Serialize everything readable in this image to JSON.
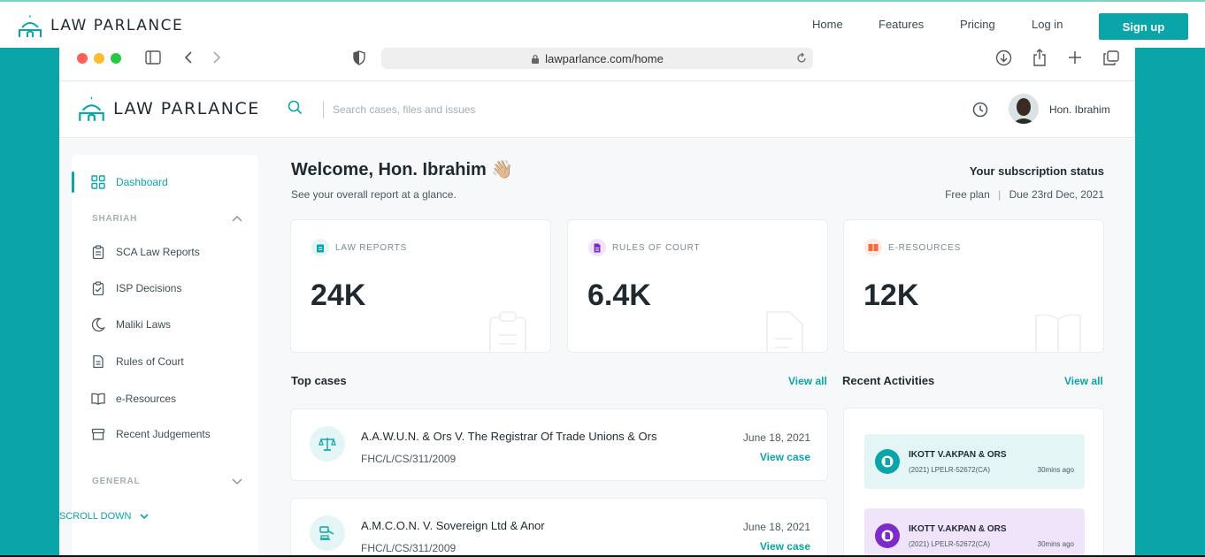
{
  "site": {
    "brand": "LAW PARLANCE",
    "nav": [
      "Home",
      "Features",
      "Pricing",
      "Log in"
    ],
    "signup_label": "Sign up"
  },
  "browser": {
    "url": "lawparlance.com/home",
    "traffic_light_colors": [
      "#ff5f57",
      "#febc2e",
      "#28c840"
    ]
  },
  "app": {
    "brand": "LAW PARLANCE",
    "search_placeholder": "Search cases, files and issues",
    "user_name": "Hon. Ibrahim"
  },
  "sidebar": {
    "active": "Dashboard",
    "sections": [
      {
        "title": "SHARIAH",
        "items": [
          {
            "label": "SCA Law Reports",
            "icon": "clipboard-list-icon"
          },
          {
            "label": "ISP Decisions",
            "icon": "clipboard-check-icon"
          },
          {
            "label": "Maliki Laws",
            "icon": "crescent-moon-icon"
          },
          {
            "label": "Rules of Court",
            "icon": "document-icon"
          },
          {
            "label": "e-Resources",
            "icon": "open-book-icon"
          },
          {
            "label": "Recent Judgements",
            "icon": "archive-box-icon"
          }
        ]
      },
      {
        "title": "GENERAL",
        "items": []
      }
    ],
    "scroll_hint": "SCROLL DOWN"
  },
  "welcome": {
    "title": "Welcome, Hon. Ibrahim 👋🏼",
    "subtitle": "See your overall report at a glance.",
    "subscription_title": "Your subscription status",
    "plan": "Free plan",
    "due": "Due 23rd Dec, 2021"
  },
  "stats": [
    {
      "label": "LAW REPORTS",
      "value": "24K",
      "color": "#0aa5a8",
      "bg": "#e3f5f5"
    },
    {
      "label": "RULES OF COURT",
      "value": "6.4K",
      "color": "#7b2cc9",
      "bg": "#f0e4fb"
    },
    {
      "label": "E-RESOURCES",
      "value": "12K",
      "color": "#f26a3d",
      "bg": "#fdebe4"
    }
  ],
  "top_cases": {
    "title": "Top cases",
    "view_all": "View all",
    "items": [
      {
        "title": "A.A.W.U.N. & Ors V. The Registrar Of Trade Unions & Ors",
        "code": "FHC/L/CS/311/2009",
        "date": "June 18, 2021",
        "action": "View case",
        "icon": "scales-icon"
      },
      {
        "title": "A.M.C.O.N. V. Sovereign Ltd & Anor",
        "code": "FHC/L/CS/311/2009",
        "date": "June 18, 2021",
        "action": "View case",
        "icon": "gavel-icon"
      }
    ]
  },
  "recent_activities": {
    "title": "Recent Activities",
    "view_all": "View all",
    "items": [
      {
        "title": "IKOTT V.AKPAN & ORS",
        "ref": "(2021) LPELR-52672(CA)",
        "time": "30mins ago",
        "color": "#0aa5a8",
        "bg": "#e3f5f5"
      },
      {
        "title": "IKOTT V.AKPAN & ORS",
        "ref": "(2021) LPELR-52672(CA)",
        "time": "30mins ago",
        "color": "#7b2cc9",
        "bg": "#f0e4fb"
      }
    ]
  }
}
